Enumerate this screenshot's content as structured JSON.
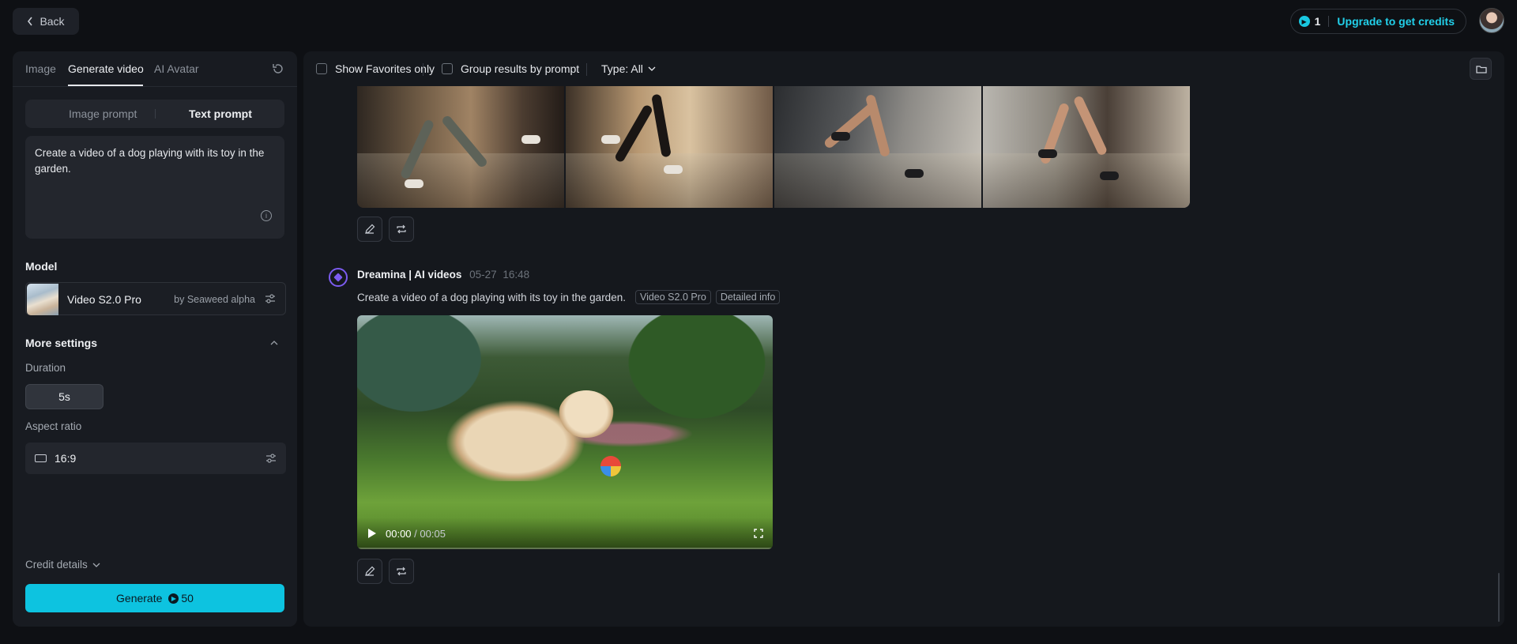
{
  "topbar": {
    "back_label": "Back",
    "credits_count": "1",
    "upgrade_label": "Upgrade to get credits"
  },
  "left": {
    "tabs": [
      {
        "label": "Image"
      },
      {
        "label": "Generate video"
      },
      {
        "label": "AI Avatar"
      }
    ],
    "prompt_modes": {
      "image": "Image prompt",
      "text": "Text prompt"
    },
    "prompt_text": "Create a video of a dog playing with its toy in the garden.",
    "model_label": "Model",
    "model_name": "Video S2.0 Pro",
    "model_by": "by Seaweed alpha",
    "more_settings": "More settings",
    "duration_label": "Duration",
    "duration_value": "5s",
    "aspect_label": "Aspect ratio",
    "aspect_value": "16:9",
    "credit_details": "Credit details",
    "generate_label": "Generate",
    "generate_cost": "50"
  },
  "main": {
    "favorites_label": "Show Favorites only",
    "group_label": "Group results by prompt",
    "type_filter": "Type: All",
    "result": {
      "author": "Dreamina | AI videos",
      "date": "05-27",
      "time": "16:48",
      "prompt": "Create a video of a dog playing with its toy in the garden.",
      "model_tag": "Video S2.0 Pro",
      "info_tag": "Detailed info",
      "current_time": "00:00",
      "duration": "/ 00:05"
    }
  },
  "colors": {
    "accent": "#0dc3e0",
    "brand_purple": "#7c5cf0",
    "background": "#0e1014"
  }
}
